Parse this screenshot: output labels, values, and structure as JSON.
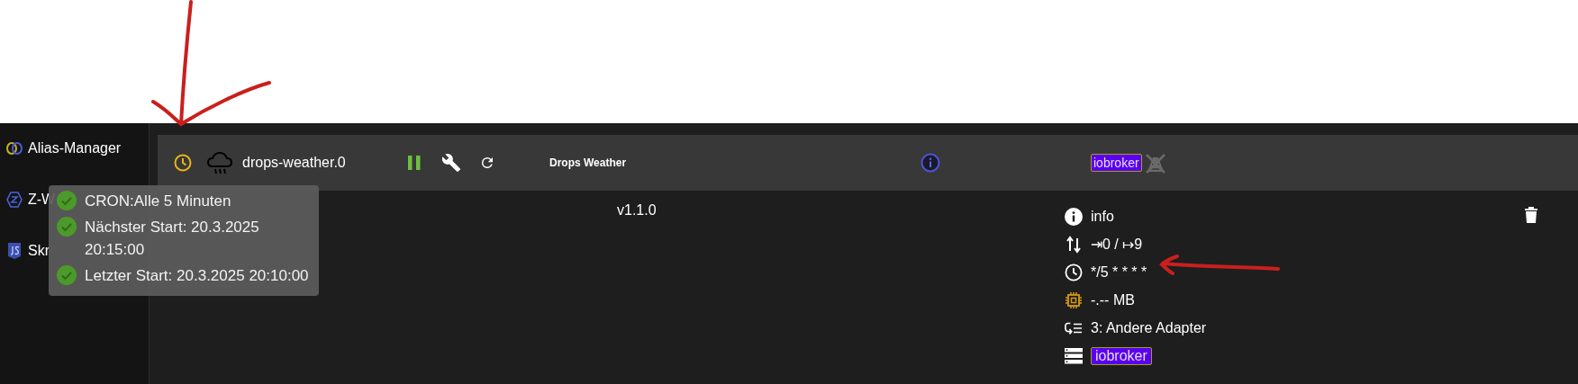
{
  "sidebar": {
    "items": [
      {
        "label": "Alias-Manager",
        "kind": "alias"
      },
      {
        "label": "Z-W",
        "kind": "zwave"
      },
      {
        "label": "Skr",
        "kind": "js"
      }
    ]
  },
  "adapter": {
    "name": "drops-weather.0",
    "title": "Drops Weather",
    "version": "v1.1.0",
    "badge": "iobroker"
  },
  "details": [
    {
      "kind": "info",
      "text": "info"
    },
    {
      "kind": "links",
      "text": "⇥0 / ↦9"
    },
    {
      "kind": "cron",
      "text": "*/5 * * * *"
    },
    {
      "kind": "memory",
      "text": "-.-- MB"
    },
    {
      "kind": "tier",
      "text": "3: Andere Adapter"
    },
    {
      "kind": "host",
      "text": "iobroker"
    }
  ],
  "tooltip": {
    "lines": [
      {
        "text": "CRON:Alle 5 Minuten"
      },
      {
        "text": "Nächster Start: 20.3.2025 20:15:00"
      },
      {
        "text": "Letzter Start: 20.3.2025 20:10:00"
      }
    ]
  }
}
